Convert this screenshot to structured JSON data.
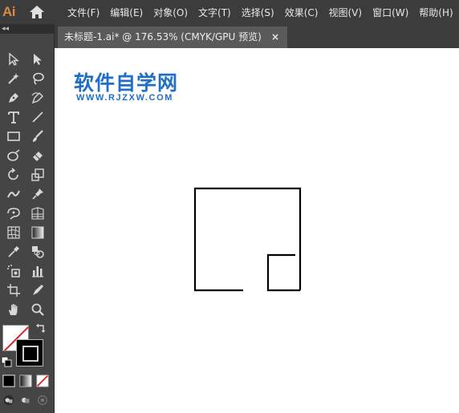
{
  "app": {
    "logo_text": "Ai"
  },
  "menu": {
    "items": [
      "文件(F)",
      "编辑(E)",
      "对象(O)",
      "文字(T)",
      "选择(S)",
      "效果(C)",
      "视图(V)",
      "窗口(W)",
      "帮助(H)"
    ]
  },
  "toolbar": {
    "collapse_glyph": "◂◂"
  },
  "document_tab": {
    "title": "未标题-1.ai* @ 176.53% (CMYK/GPU 预览)",
    "close_glyph": "×"
  },
  "watermark": {
    "title": "软件自学网",
    "subtitle": "WWW.RJZXW.COM"
  },
  "colors": {
    "accent": "#1f6fc9",
    "ai_logo": "#d98b45",
    "none_slash": "#e02020"
  }
}
